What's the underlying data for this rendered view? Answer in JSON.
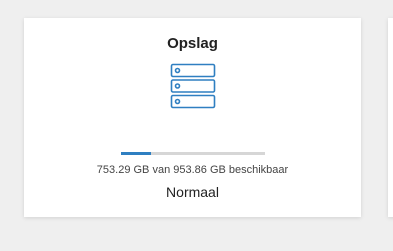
{
  "card": {
    "title": "Opslag",
    "icon": "storage-drives-icon",
    "usage": {
      "used_fraction": 0.21,
      "capacity_text": "753.29 GB van 953.86 GB beschikbaar"
    },
    "status": "Normaal"
  },
  "colors": {
    "accent": "#2f7fc1",
    "track": "#d6d6d6",
    "background": "#efefef",
    "card": "#ffffff"
  }
}
